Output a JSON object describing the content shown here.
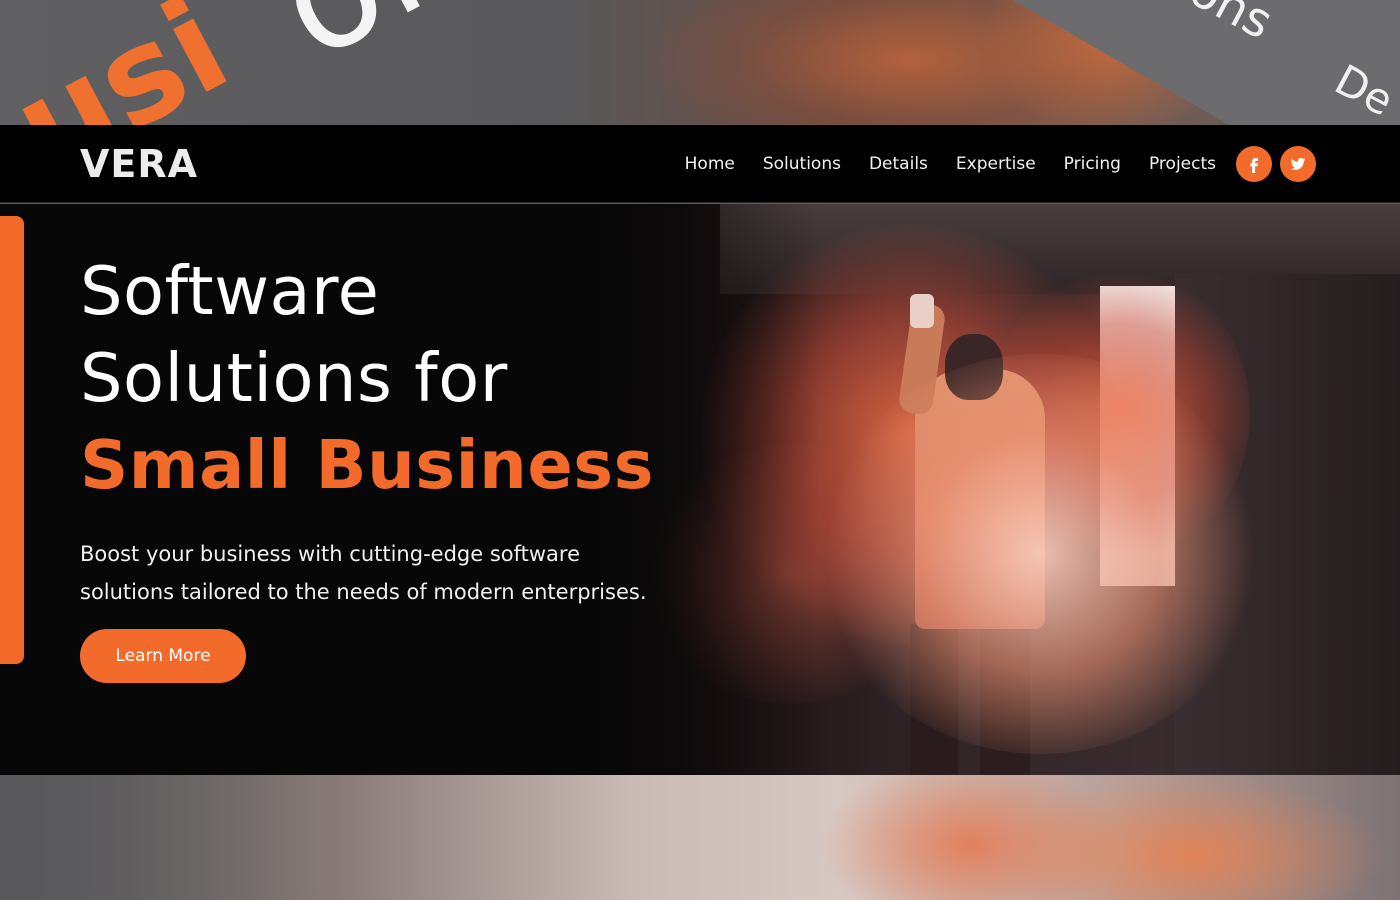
{
  "background": {
    "top_fragments": [
      "or",
      "usi",
      "ions",
      "De"
    ]
  },
  "header": {
    "logo": "VERA",
    "nav": [
      {
        "label": "Home"
      },
      {
        "label": "Solutions"
      },
      {
        "label": "Details"
      },
      {
        "label": "Expertise"
      },
      {
        "label": "Pricing"
      },
      {
        "label": "Projects"
      }
    ],
    "socials": [
      {
        "icon": "facebook-icon",
        "glyph": "f"
      },
      {
        "icon": "twitter-icon",
        "glyph": "t"
      }
    ]
  },
  "hero": {
    "title_line1": "Software",
    "title_line2": "Solutions for",
    "title_accent": "Small Business",
    "subtitle": "Boost your business with cutting-edge software solutions tailored to the needs of modern enterprises.",
    "cta_label": "Learn More"
  },
  "colors": {
    "accent": "#f36b2b",
    "header_bg": "#000000",
    "hero_bg": "#070707",
    "text": "#ffffff"
  }
}
